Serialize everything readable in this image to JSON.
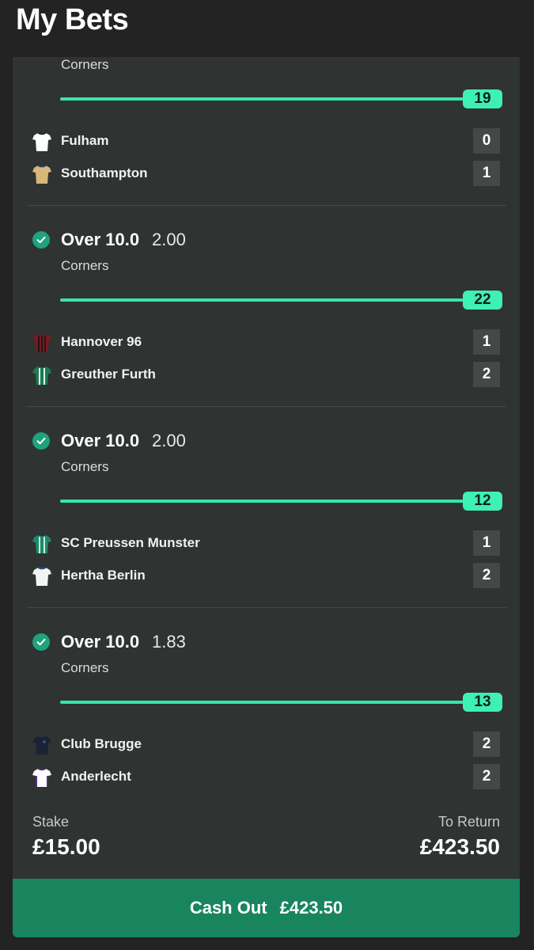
{
  "header": {
    "title": "My Bets"
  },
  "top_bet": {
    "market": "Corners",
    "progress_value": "19",
    "teams": [
      {
        "name": "Fulham",
        "score": "0",
        "kit": "fulham-shirt-icon",
        "colors": [
          "#ffffff",
          "#222222"
        ]
      },
      {
        "name": "Southampton",
        "score": "1",
        "kit": "southampton-shirt-icon",
        "colors": [
          "#d8b77a",
          "#2c3a66"
        ]
      }
    ]
  },
  "bets": [
    {
      "selection": "Over 10.0",
      "odds": "2.00",
      "market": "Corners",
      "progress_value": "22",
      "teams": [
        {
          "name": "Hannover 96",
          "score": "1",
          "colors": [
            "#7a1a22",
            "#111111"
          ]
        },
        {
          "name": "Greuther Furth",
          "score": "2",
          "colors": [
            "#1a7d4f",
            "#ffffff"
          ]
        }
      ]
    },
    {
      "selection": "Over 10.0",
      "odds": "2.00",
      "market": "Corners",
      "progress_value": "12",
      "teams": [
        {
          "name": "SC Preussen Munster",
          "score": "1",
          "colors": [
            "#1c8a6a",
            "#ffffff"
          ]
        },
        {
          "name": "Hertha Berlin",
          "score": "2",
          "colors": [
            "#f4f4f4",
            "#2455a5"
          ]
        }
      ]
    },
    {
      "selection": "Over 10.0",
      "odds": "1.83",
      "market": "Corners",
      "progress_value": "13",
      "teams": [
        {
          "name": "Club Brugge",
          "score": "2",
          "colors": [
            "#1a2233",
            "#2a4f8a"
          ]
        },
        {
          "name": "Anderlecht",
          "score": "2",
          "colors": [
            "#ffffff",
            "#5a2d8a"
          ]
        }
      ]
    }
  ],
  "summary": {
    "stake_label": "Stake",
    "stake_value": "£15.00",
    "return_label": "To Return",
    "return_value": "£423.50"
  },
  "cashout": {
    "label": "Cash Out",
    "amount": "£423.50"
  },
  "colors": {
    "accent": "#3ef0b3",
    "button": "#18855f",
    "check": "#1ea37c",
    "panel": "#2f3331"
  }
}
